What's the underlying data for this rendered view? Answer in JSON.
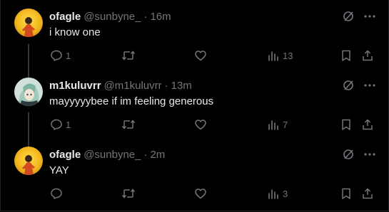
{
  "thread": [
    {
      "display_name": "ofagle",
      "handle": "@sunbyne_",
      "separator": "·",
      "time": "16m",
      "text": "i know one",
      "replies": "1",
      "reposts": "",
      "likes": "",
      "views": "13",
      "avatar": "golden-figure-avatar"
    },
    {
      "display_name": "m1kuluvrr",
      "handle": "@m1kuluvrr",
      "separator": "·",
      "time": "13m",
      "text": "mayyyyybee if im feeling generous",
      "replies": "1",
      "reposts": "",
      "likes": "",
      "views": "7",
      "avatar": "anime-character-avatar"
    },
    {
      "display_name": "ofagle",
      "handle": "@sunbyne_",
      "separator": "·",
      "time": "2m",
      "text": "YAY",
      "replies": "",
      "reposts": "",
      "likes": "",
      "views": "3",
      "avatar": "golden-figure-avatar"
    }
  ],
  "icons": {
    "reply": "reply-icon",
    "repost": "repost-icon",
    "like": "heart-icon",
    "views": "views-icon",
    "bookmark": "bookmark-icon",
    "share": "share-icon",
    "grok": "grok-icon",
    "more": "more-icon"
  },
  "colors": {
    "background": "#000000",
    "primary_text": "#e7e9ea",
    "secondary_text": "#71767b",
    "thread_line": "#333639"
  }
}
